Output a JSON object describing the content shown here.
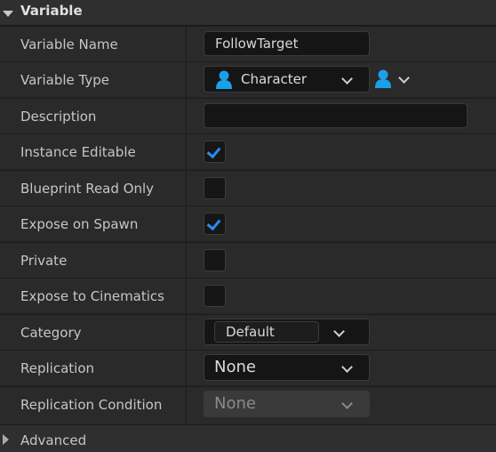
{
  "section": {
    "title": "Variable"
  },
  "rows": {
    "variable_name": {
      "label": "Variable Name",
      "value": "FollowTarget"
    },
    "variable_type": {
      "label": "Variable Type",
      "value": "Character",
      "icon": "person-icon",
      "icon_color": "#1aa0ea"
    },
    "description": {
      "label": "Description",
      "value": ""
    },
    "instance_editable": {
      "label": "Instance Editable",
      "checked": true
    },
    "blueprint_read_only": {
      "label": "Blueprint Read Only",
      "checked": false
    },
    "expose_on_spawn": {
      "label": "Expose on Spawn",
      "checked": true
    },
    "private": {
      "label": "Private",
      "checked": false
    },
    "expose_to_cinematics": {
      "label": "Expose to Cinematics",
      "checked": false
    },
    "category": {
      "label": "Category",
      "value": "Default"
    },
    "replication": {
      "label": "Replication",
      "value": "None"
    },
    "replication_condition": {
      "label": "Replication Condition",
      "value": "None",
      "enabled": false
    }
  },
  "footer": {
    "title": "Advanced"
  },
  "colors": {
    "accent": "#2a8cf0",
    "panel_bg": "#2a2a2a",
    "field_bg": "#151515"
  }
}
